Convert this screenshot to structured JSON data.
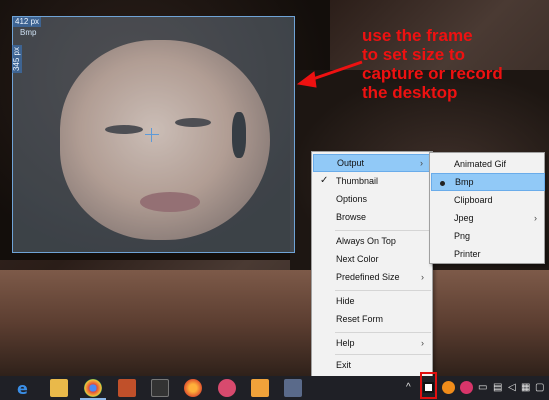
{
  "frame": {
    "width_label": "412 px",
    "height_label": "345 px",
    "format_label": "Bmp"
  },
  "annotation": {
    "lines": [
      "use the frame",
      "to set size to",
      "capture or record",
      "the desktop"
    ],
    "color": "#ee1111"
  },
  "menu": {
    "items": [
      {
        "label": "Output",
        "checked": false,
        "submenu": true
      },
      {
        "label": "Thumbnail",
        "checked": true,
        "submenu": false
      },
      {
        "label": "Options",
        "checked": false,
        "submenu": false
      },
      {
        "label": "Browse",
        "checked": false,
        "submenu": false
      },
      {
        "label": "Always On Top",
        "checked": false,
        "submenu": false
      },
      {
        "label": "Next Color",
        "checked": false,
        "submenu": false
      },
      {
        "label": "Predefined Size",
        "checked": false,
        "submenu": true
      },
      {
        "label": "Hide",
        "checked": false,
        "submenu": false
      },
      {
        "label": "Reset Form",
        "checked": false,
        "submenu": false
      },
      {
        "label": "Help",
        "checked": false,
        "submenu": true
      },
      {
        "label": "Exit",
        "checked": false,
        "submenu": false
      }
    ],
    "check_glyph": "✓",
    "submenu_glyph": "›"
  },
  "output_submenu": {
    "items": [
      {
        "label": "Animated Gif",
        "selected": false
      },
      {
        "label": "Bmp",
        "selected": true
      },
      {
        "label": "Clipboard",
        "selected": false
      },
      {
        "label": "Jpeg",
        "selected": false,
        "submenu": true
      },
      {
        "label": "Png",
        "selected": false
      },
      {
        "label": "Printer",
        "selected": false
      }
    ]
  },
  "taskbar": {
    "icons": [
      "edge-icon",
      "file-explorer-icon",
      "chrome-icon",
      "game-icon",
      "media-player-icon",
      "firefox-icon",
      "chat-icon",
      "video-icon",
      "network-tool-icon"
    ],
    "tray": [
      "chevron-up-icon",
      "capture-app-icon",
      "orange-app-icon",
      "pink-app-icon",
      "battery-icon",
      "network-icon",
      "volume-icon",
      "keyboard-icon",
      "notification-icon"
    ]
  },
  "colors": {
    "accent": "#91c9f7",
    "frame": "#6fa3d6",
    "annotation": "#ee1111"
  }
}
